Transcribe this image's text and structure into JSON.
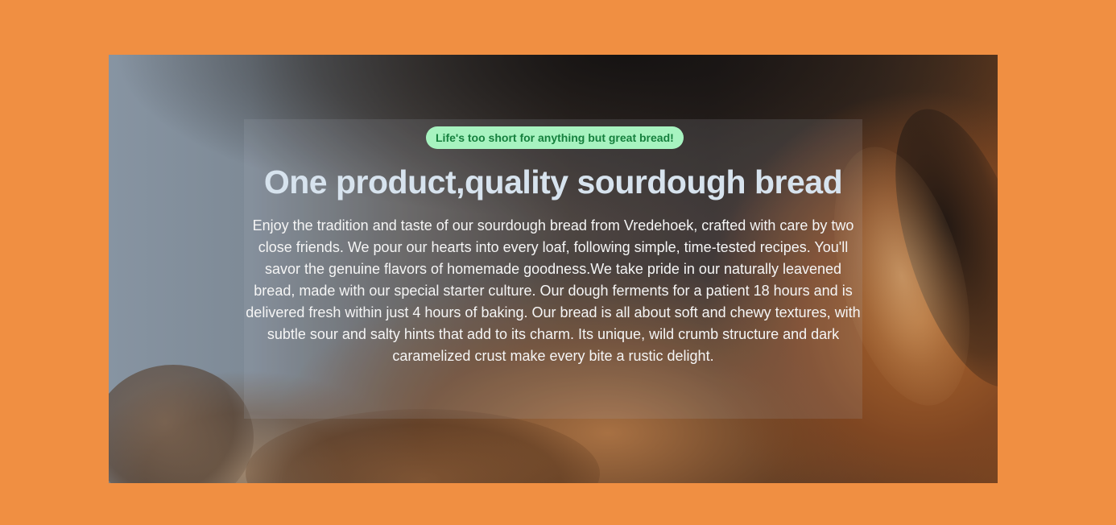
{
  "hero": {
    "badge": "Life's too short for anything but great bread!",
    "title": "One product,quality sourdough bread",
    "description": "Enjoy the tradition and taste of our sourdough bread from Vredehoek, crafted with care by two close friends. We pour our hearts into every loaf, following simple, time-tested recipes. You'll savor the genuine flavors of homemade goodness.We take pride in our naturally leavened bread, made with our special starter culture. Our dough ferments for a patient 18 hours and is delivered fresh within just 4 hours of baking. Our bread is all about soft and chewy textures, with subtle sour and salty hints that add to its charm. Its unique, wild crumb structure and dark caramelized crust make every bite a rustic delight."
  },
  "colors": {
    "page_background": "#F08F42",
    "badge_background": "#A7F3C0",
    "badge_text": "#15803D",
    "title_text": "#D7E3EE",
    "body_text": "#F5F5F5"
  }
}
